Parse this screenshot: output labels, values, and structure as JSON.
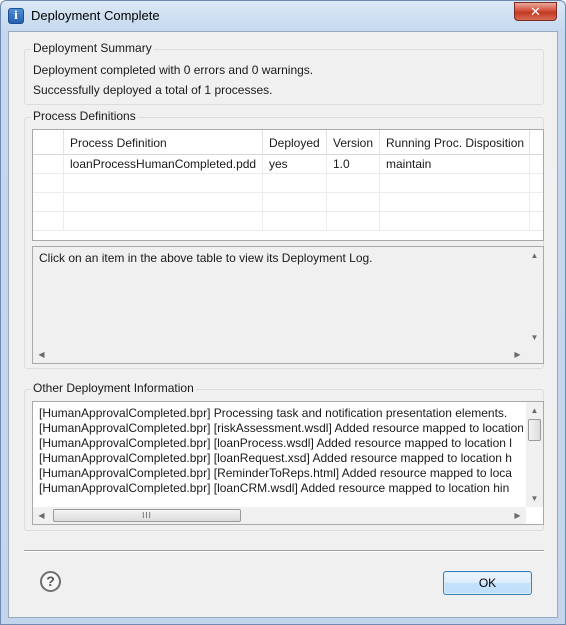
{
  "window": {
    "title": "Deployment Complete",
    "close_label": "✕"
  },
  "summary": {
    "group_title": "Deployment Summary",
    "line1": "Deployment completed with 0 errors and 0 warnings.",
    "line2": "Successfully deployed a total of 1 processes."
  },
  "process_definitions": {
    "group_title": "Process Definitions",
    "columns": [
      "",
      "Process Definition",
      "Deployed",
      "Version",
      "Running Proc. Disposition"
    ],
    "rows": [
      [
        "",
        "loanProcessHumanCompleted.pdd",
        "yes",
        "1.0",
        "maintain"
      ]
    ],
    "log_hint": "Click on an item in the above table to view its Deployment Log."
  },
  "other_info": {
    "group_title": "Other Deployment Information",
    "lines": [
      "[HumanApprovalCompleted.bpr] Processing task and notification presentation elements.",
      "[HumanApprovalCompleted.bpr] [riskAssessment.wsdl] Added resource mapped to location",
      "[HumanApprovalCompleted.bpr] [loanProcess.wsdl] Added resource mapped to location l",
      "[HumanApprovalCompleted.bpr] [loanRequest.xsd] Added resource mapped to location h",
      "[HumanApprovalCompleted.bpr] [ReminderToReps.html] Added resource mapped to loca",
      "[HumanApprovalCompleted.bpr] [loanCRM.wsdl] Added resource mapped to location hin"
    ],
    "hscroll_grip": "III"
  },
  "footer": {
    "help_label": "?",
    "ok_label": "OK"
  }
}
